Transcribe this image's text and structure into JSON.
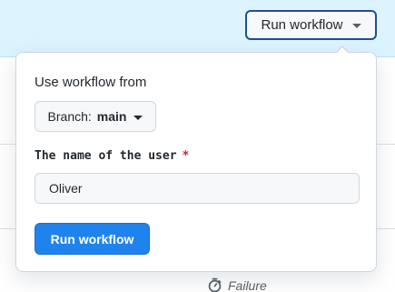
{
  "header": {
    "run_workflow_button_label": "Run workflow"
  },
  "popover": {
    "use_workflow_label": "Use workflow from",
    "branch_prefix": "Branch:",
    "branch_name": "main",
    "input_label": "The name of the user",
    "required_marker": "*",
    "input_value": "Oliver",
    "submit_label": "Run workflow"
  },
  "background": {
    "status_text": "Failure",
    "status_icon": "stopwatch-icon"
  },
  "colors": {
    "banner_bg": "#ddf4ff",
    "primary_button": "#1f83ed",
    "required": "#cf222e"
  }
}
